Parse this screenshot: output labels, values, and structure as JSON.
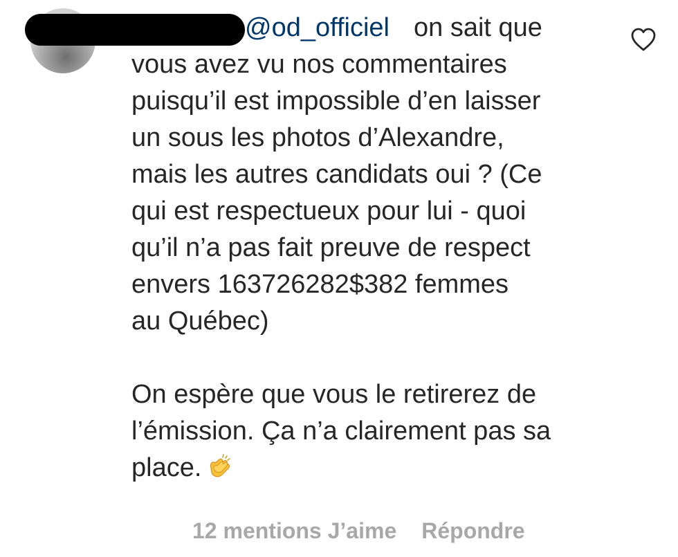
{
  "comment": {
    "mention": "@od_officiel",
    "first_line": "on sait que",
    "lines": [
      "vous avez vu nos commentaires",
      "puisqu’il est impossible d’en laisser",
      "un sous les photos d’Alexandre,",
      "mais les autres candidats oui ? (Ce",
      "qui est respectueux pour lui - quoi",
      "qu’il n’a pas fait preuve de respect",
      "envers 163726282$382 femmes",
      "au Québec)"
    ],
    "lines2": [
      "On espère que vous le retirerez de",
      "l’émission. Ça n’a clairement pas sa",
      "place."
    ],
    "emoji": "clapping-hands-icon"
  },
  "actions": {
    "likes": "12 mentions J’aime",
    "reply": "Répondre"
  },
  "colors": {
    "text": "#262626",
    "mention": "#00376b",
    "secondary": "#a8a8a8",
    "emoji": "#f7c23a"
  }
}
